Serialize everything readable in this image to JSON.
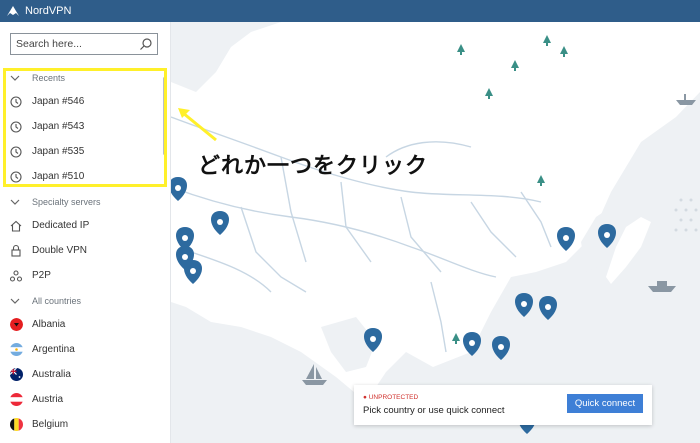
{
  "app": {
    "title": "NordVPN"
  },
  "search": {
    "placeholder": "Search here..."
  },
  "sidebar": {
    "recents_label": "Recents",
    "recents": [
      "Japan #546",
      "Japan #543",
      "Japan #535",
      "Japan #510"
    ],
    "specialty_label": "Specialty servers",
    "specialty": [
      {
        "label": "Dedicated IP",
        "icon": "house-icon"
      },
      {
        "label": "Double VPN",
        "icon": "lock-icon"
      },
      {
        "label": "P2P",
        "icon": "p2p-icon"
      }
    ],
    "countries_label": "All countries",
    "countries": [
      "Albania",
      "Argentina",
      "Australia",
      "Austria",
      "Belgium"
    ]
  },
  "annotation": {
    "text": "どれか一つをクリック",
    "color": "#fff02a"
  },
  "status": {
    "state": "UNPROTECTED",
    "message": "Pick country or use quick connect",
    "button": "Quick connect"
  },
  "colors": {
    "titlebar": "#2f5d8a",
    "accent": "#3e7fd6",
    "pin": "#2d6a9f",
    "land": "#ffffff",
    "water": "#eef1f4"
  }
}
